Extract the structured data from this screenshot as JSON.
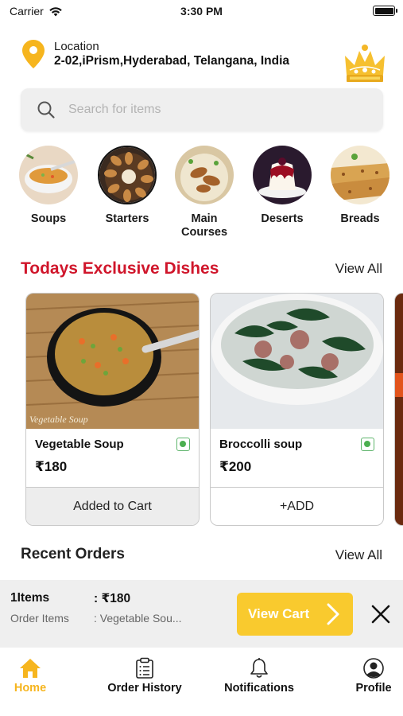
{
  "status_bar": {
    "carrier": "Carrier",
    "time": "3:30 PM"
  },
  "location": {
    "label": "Location",
    "value": "2-02,iPrism,Hyderabad, Telangana, India"
  },
  "search": {
    "placeholder": "Search for items"
  },
  "categories": [
    {
      "label": "Soups"
    },
    {
      "label": "Starters"
    },
    {
      "label": "Main Courses"
    },
    {
      "label": "Deserts"
    },
    {
      "label": "Breads"
    }
  ],
  "exclusive": {
    "title": "Todays Exclusive Dishes",
    "view_all": "View All",
    "dishes": [
      {
        "name": "Vegetable Soup",
        "price": "₹180",
        "action": "Added to Cart",
        "photo_caption": "Vegetable Soup"
      },
      {
        "name": "Broccolli soup",
        "price": "₹200",
        "action": "+ADD"
      }
    ]
  },
  "recent_orders": {
    "title": "Recent Orders",
    "view_all": "View All"
  },
  "cart": {
    "items": "1Items",
    "price": ": ₹180",
    "order_label": "Order Items",
    "order_value": ": Vegetable Sou...",
    "view_cart": "View Cart"
  },
  "tabs": [
    {
      "label": "Home",
      "icon": "home-icon",
      "active": true
    },
    {
      "label": "Order History",
      "icon": "clipboard-icon"
    },
    {
      "label": "Notifications",
      "icon": "bell-icon"
    },
    {
      "label": "Profile",
      "icon": "user-icon"
    }
  ],
  "colors": {
    "accent": "#f6b51e",
    "title_red": "#d0162b",
    "veg_green": "#4caf50",
    "cart_button": "#f9ca2e"
  }
}
